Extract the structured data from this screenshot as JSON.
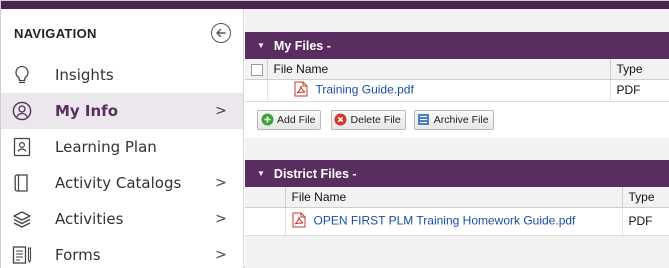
{
  "sidebar": {
    "title": "NAVIGATION",
    "collapse_icon": "arrow-left-circle-icon",
    "items": [
      {
        "label": "Insights",
        "icon": "lightbulb-icon",
        "chevron": ""
      },
      {
        "label": "My Info",
        "icon": "user-circle-icon",
        "chevron": ">"
      },
      {
        "label": "Learning Plan",
        "icon": "id-card-icon",
        "chevron": ""
      },
      {
        "label": "Activity Catalogs",
        "icon": "book-icon",
        "chevron": ">"
      },
      {
        "label": "Activities",
        "icon": "layers-icon",
        "chevron": ">"
      },
      {
        "label": "Forms",
        "icon": "forms-icon",
        "chevron": ">"
      }
    ],
    "active_index": 1
  },
  "my_files": {
    "title": "My Files -",
    "columns": [
      "File Name",
      "Type"
    ],
    "rows": [
      {
        "name": "Training Guide.pdf",
        "type": "PDF"
      }
    ],
    "buttons": {
      "add": "Add File",
      "delete": "Delete File",
      "archive": "Archive File"
    }
  },
  "district_files": {
    "title": "District Files -",
    "columns": [
      "File Name",
      "Type"
    ],
    "rows": [
      {
        "name": "OPEN FIRST PLM Training Homework Guide.pdf",
        "type": "PDF"
      }
    ]
  },
  "colors": {
    "accent": "#5a2d60",
    "link": "#1a4fa8",
    "active_bg": "#ebe7ec"
  }
}
